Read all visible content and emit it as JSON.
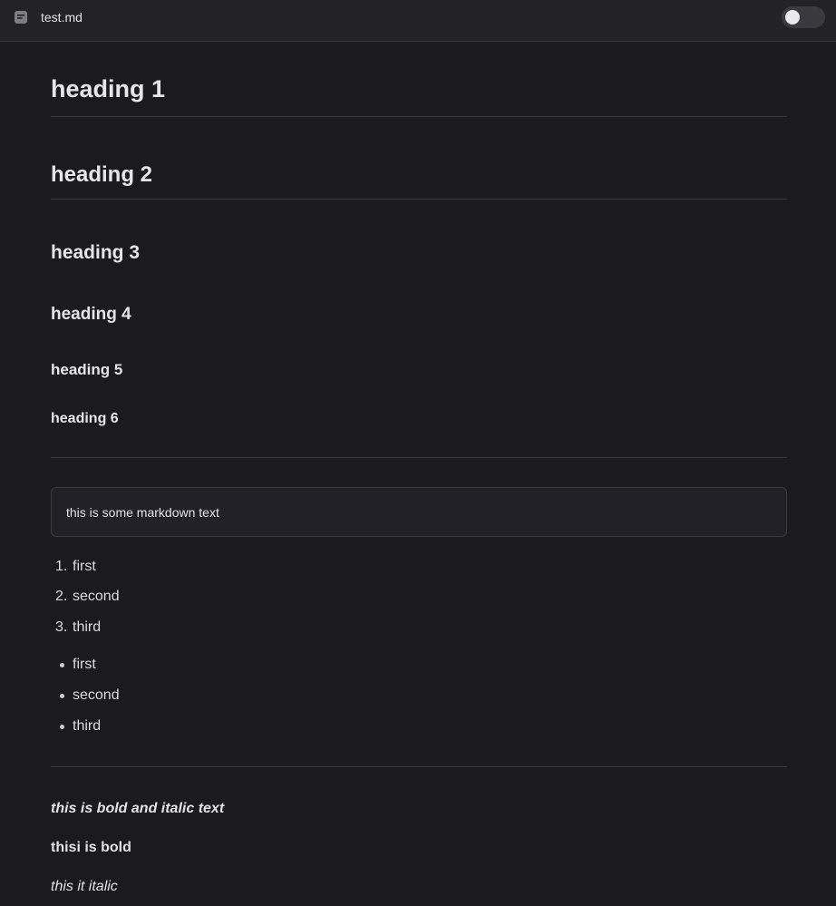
{
  "topbar": {
    "file_icon": "document-icon",
    "file_name": "test.md",
    "theme_toggle_icon": "toggle-switch"
  },
  "document": {
    "h1": "heading 1",
    "h2": "heading 2",
    "h3": "heading 3",
    "h4": "heading 4",
    "h5": "heading 5",
    "h6": "heading 6",
    "code_block_text": "this is some markdown text",
    "ordered_list": [
      {
        "marker": "1.",
        "text": "first"
      },
      {
        "marker": "2.",
        "text": "second"
      },
      {
        "marker": "3.",
        "text": "third"
      }
    ],
    "bullet_list": [
      "first",
      "second",
      "third"
    ],
    "bold_italic_text": "this is bold and italic text",
    "bold_text": "thisi is bold",
    "italic_text": "this it italic"
  },
  "colors": {
    "background": "#1b1a1d",
    "topbar": "#232225",
    "text": "#e3e3e6",
    "rule": "#3a393d"
  }
}
